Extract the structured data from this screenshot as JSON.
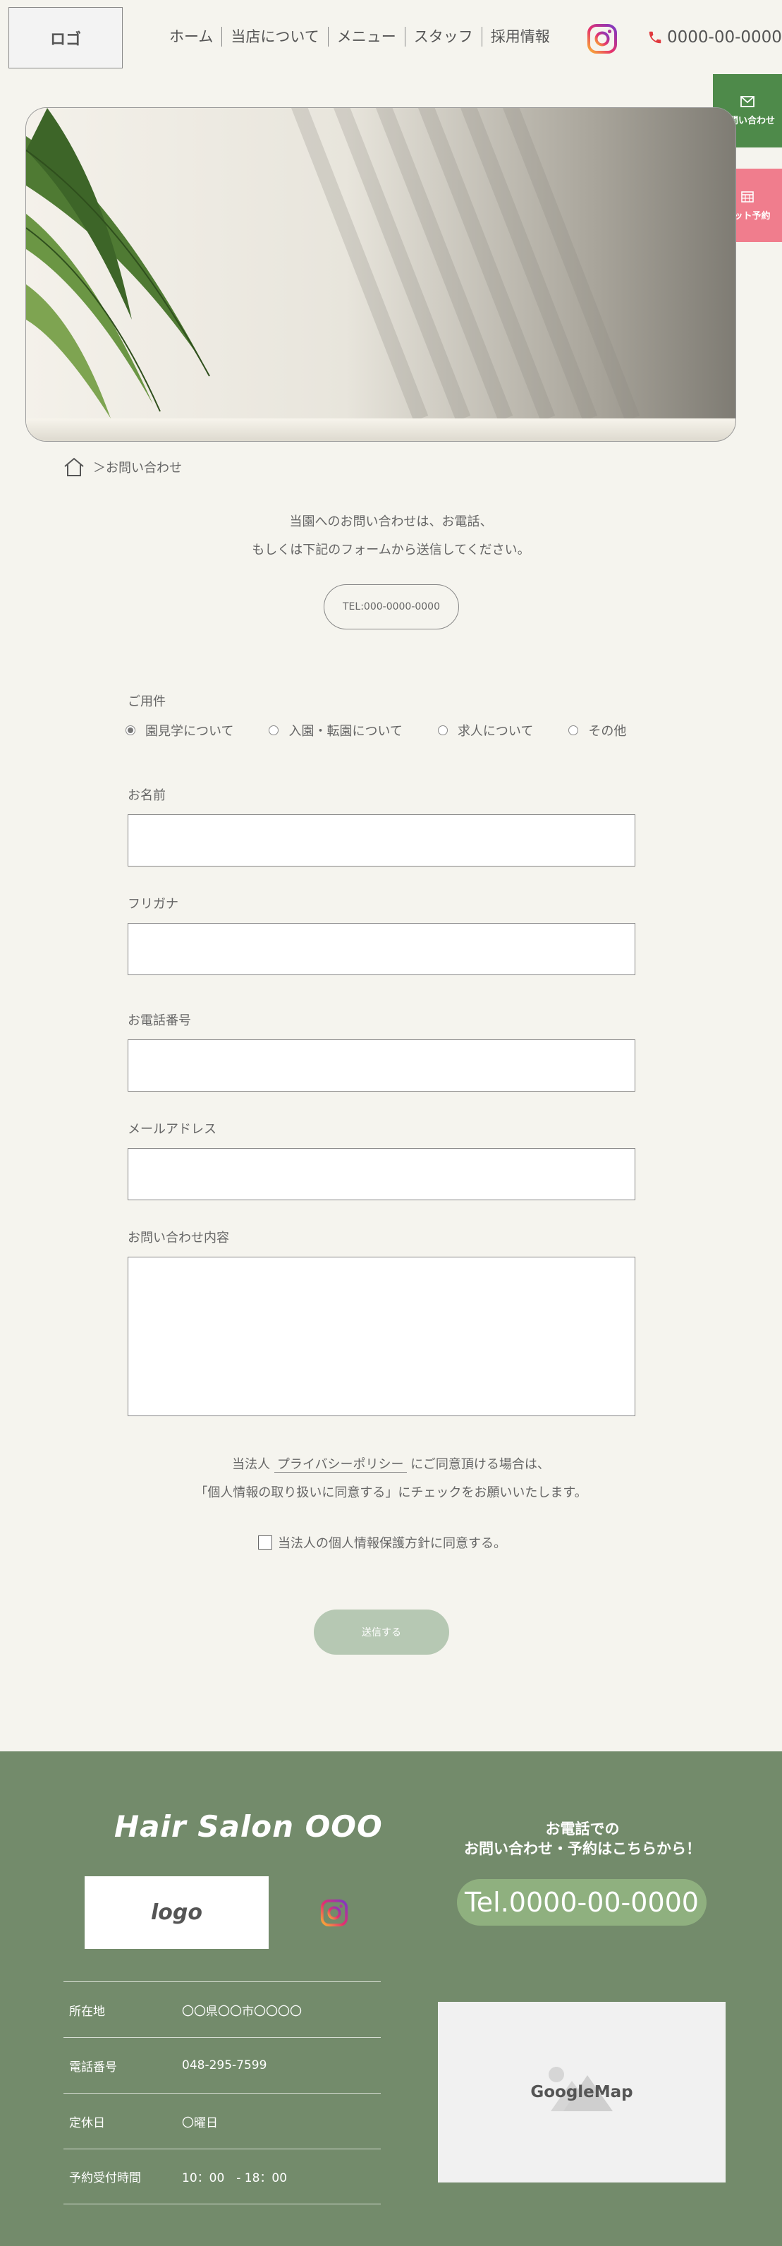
{
  "header": {
    "logo": "ロゴ",
    "nav": [
      "ホーム",
      "当店について",
      "メニュー",
      "スタッフ",
      "採用情報"
    ],
    "phone": "0000-00-0000"
  },
  "side_tabs": {
    "contact": "お問い合わせ",
    "reserve": "ネット予約"
  },
  "breadcrumb": {
    "current": "＞お問い合わせ"
  },
  "intro": {
    "line1": "当園へのお問い合わせは、お電話、",
    "line2": "もしくは下記のフォームから送信してください。",
    "tel_button": "TEL:000-0000-0000"
  },
  "form": {
    "purpose_label": "ご用件",
    "purpose_options": [
      {
        "label": "園見学について",
        "checked": true
      },
      {
        "label": "入園・転園について",
        "checked": false
      },
      {
        "label": "求人について",
        "checked": false
      },
      {
        "label": "その他",
        "checked": false
      }
    ],
    "name_label": "お名前",
    "kana_label": "フリガナ",
    "tel_label": "お電話番号",
    "email_label": "メールアドレス",
    "message_label": "お問い合わせ内容",
    "consent_prefix": "当法人",
    "consent_link": "プライバシーポリシー",
    "consent_suffix": "にご同意頂ける場合は、",
    "consent_line2": "「個人情報の取り扱いに同意する」にチェックをお願いいたします。",
    "agree_label": "当法人の個人情報保護方針に同意する。",
    "submit_label": "送信する"
  },
  "footer": {
    "salon_name": "Hair Salon OOO",
    "logo": "logo",
    "info": [
      {
        "key": "所在地",
        "value": "〇〇県〇〇市〇〇〇〇"
      },
      {
        "key": "電話番号",
        "value": "048-295-7599"
      },
      {
        "key": "定休日",
        "value": "〇曜日"
      },
      {
        "key": "予約受付時間",
        "value": "10：00　- 18：00"
      }
    ],
    "phone_cta_line1": "お電話での",
    "phone_cta_line2": "お問い合わせ・予約はこちらから！",
    "phone_cta_number": "Tel.0000-00-0000",
    "map_label": "GoogleMap"
  }
}
